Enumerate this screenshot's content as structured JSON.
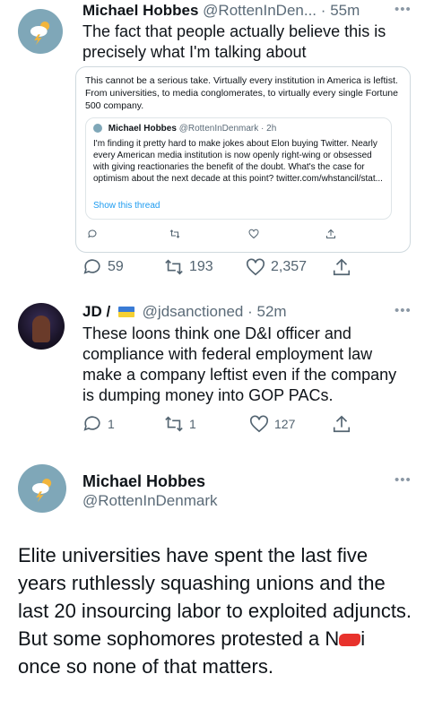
{
  "tweet1": {
    "name": "Michael Hobbes",
    "handle": "@RottenInDen...",
    "time": "55m",
    "text": "The fact that people actually believe this is precisely what I'm talking about",
    "quoted": {
      "text": "This cannot be a serious take. Virtually every institution in America is leftist. From universities, to media conglomerates, to virtually every single Fortune 500 company.",
      "inner": {
        "name": "Michael Hobbes",
        "handle": "@RottenInDenmark",
        "time": "2h",
        "text": "I'm finding it pretty hard to make jokes about Elon buying Twitter. Nearly every American media institution is now openly right-wing or obsessed with giving reactionaries the benefit of the doubt. What's the case for optimism about the next decade at this point? twitter.com/whstancil/stat...",
        "show_thread": "Show this thread"
      }
    },
    "replies": "59",
    "retweets": "193",
    "likes": "2,357"
  },
  "tweet2": {
    "name": "JD /",
    "handle": "@jdsanctioned",
    "time": "52m",
    "text": "These loons think one D&I officer and compliance with federal employment law make a company leftist even if the company is dumping money into GOP PACs.",
    "replies": "1",
    "retweets": "1",
    "likes": "127"
  },
  "tweet3": {
    "name": "Michael Hobbes",
    "handle": "@RottenInDenmark",
    "text_before": "Elite universities have spent the last five years ruthlessly squashing unions and the last 20 insourcing labor to exploited adjuncts. But some sophomores protested a N",
    "text_after": "i once so none of that matters."
  },
  "colors": {
    "link": "#1d9bf0",
    "muted": "#536471",
    "redaction": "#e8322c"
  }
}
